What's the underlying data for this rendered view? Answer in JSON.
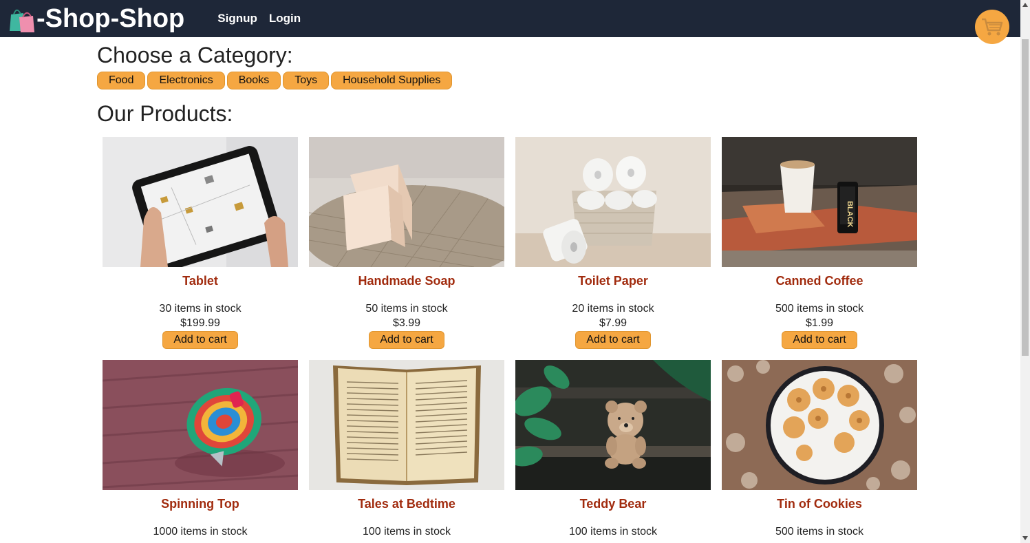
{
  "brand": {
    "name": "-Shop-Shop",
    "logo_icon": "shopping-bags-icon"
  },
  "nav": {
    "signup": "Signup",
    "login": "Login"
  },
  "cart": {
    "icon": "shopping-cart-icon"
  },
  "categories": {
    "title": "Choose a Category:",
    "items": [
      "Food",
      "Electronics",
      "Books",
      "Toys",
      "Household Supplies"
    ]
  },
  "products": {
    "title": "Our Products:",
    "add_label": "Add to cart",
    "items": [
      {
        "name": "Tablet",
        "stock": "30 items in stock",
        "price": "$199.99"
      },
      {
        "name": "Handmade Soap",
        "stock": "50 items in stock",
        "price": "$3.99"
      },
      {
        "name": "Toilet Paper",
        "stock": "20 items in stock",
        "price": "$7.99"
      },
      {
        "name": "Canned Coffee",
        "stock": "500 items in stock",
        "price": "$1.99"
      },
      {
        "name": "Spinning Top",
        "stock": "1000 items in stock",
        "price": ""
      },
      {
        "name": "Tales at Bedtime",
        "stock": "100 items in stock",
        "price": ""
      },
      {
        "name": "Teddy Bear",
        "stock": "100 items in stock",
        "price": ""
      },
      {
        "name": "Tin of Cookies",
        "stock": "500 items in stock",
        "price": ""
      }
    ]
  },
  "colors": {
    "navbar": "#1e2738",
    "accent": "#f5a742",
    "product_name": "#a12b0e"
  }
}
